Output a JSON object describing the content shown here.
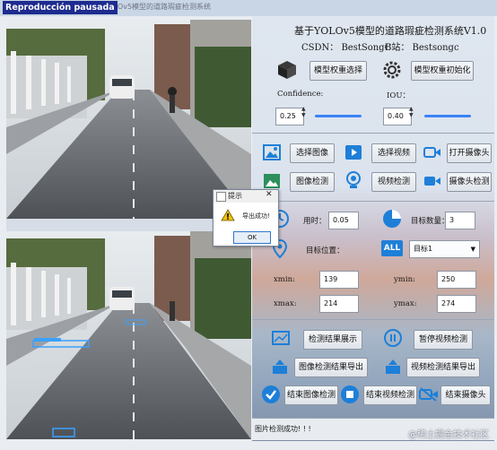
{
  "window": {
    "title": "基于YOLOv5模型的道路瑕疵检测系统",
    "play_label": "Reproducción pausada"
  },
  "header": {
    "title": "基于YOLOv5模型的道路瑕疵检测系统V1.0",
    "csdn": "CSDN：  BestSongC",
    "bilibili": "B站：  Bestsongc"
  },
  "model": {
    "select_label": "模型权重选择",
    "init_label": "模型权重初始化"
  },
  "confidence": {
    "label": "Confidence:",
    "value": "0.25",
    "fraction": 0.25
  },
  "iou": {
    "label": "IOU：",
    "value": "0.40",
    "fraction": 0.4
  },
  "actions": {
    "select_image": "选择图像",
    "select_video": "选择视频",
    "open_camera": "打开摄像头",
    "image_detect": "图像检测",
    "video_detect": "视频检测",
    "camera_detect": "摄像头检测"
  },
  "results": {
    "time_label": "用时：",
    "time_value": "0.05",
    "count_label": "目标数量：",
    "count_value": "3",
    "position_label": "目标位置：",
    "target_selected": "目标1",
    "xmin_label": "xmin:",
    "xmin_value": "139",
    "ymin_label": "ymin:",
    "ymin_value": "250",
    "xmax_label": "xmax:",
    "xmax_value": "214",
    "ymax_label": "ymax:",
    "ymax_value": "274"
  },
  "bottom_actions": {
    "show_result": "检测结果展示",
    "pause_video": "暂停视频检测",
    "export_image": "图像检测结果导出",
    "export_video": "视频检测结果导出",
    "end_image": "结束图像检测",
    "end_video": "结束视频检测",
    "end_camera": "结束摄像头"
  },
  "dialog": {
    "title": "提示",
    "message": "导出成功!",
    "ok": "OK",
    "close": "✕"
  },
  "status": {
    "text": "图片检测成功! ! !"
  },
  "watermark": "@稀土掘金技术社区",
  "colors": {
    "accent": "#1e7fd8",
    "slider": "#3b82f6",
    "detection_box": "#3aa0ff"
  }
}
